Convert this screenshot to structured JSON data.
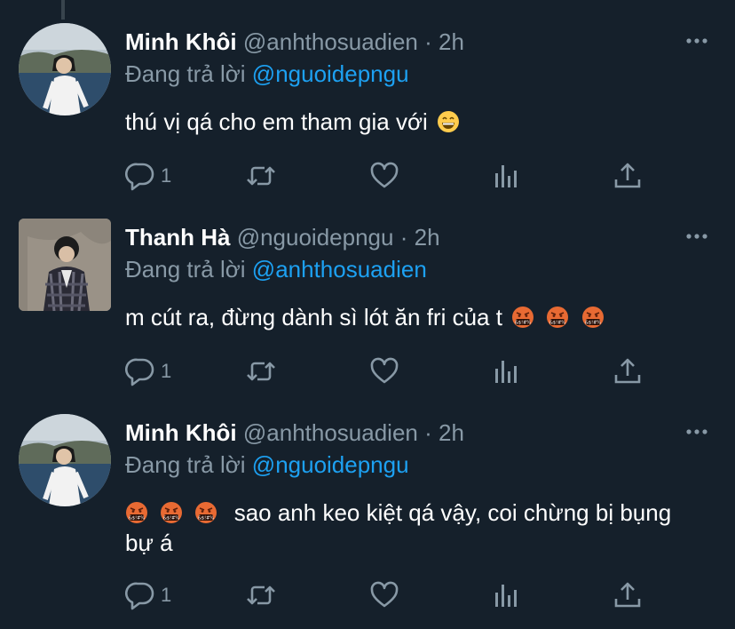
{
  "tweets": [
    {
      "name": "Minh Khôi",
      "handle": "@anhthosuadien",
      "separator": "·",
      "time": "2h",
      "reply_prefix": "Đang trả lời",
      "reply_to": "@nguoidepngu",
      "text": "thú vị qá cho em tham gia với",
      "emojis": [
        "grinning-face"
      ],
      "reply_count": "1"
    },
    {
      "name": "Thanh Hà",
      "handle": "@nguoidepngu",
      "separator": "·",
      "time": "2h",
      "reply_prefix": "Đang trả lời",
      "reply_to": "@anhthosuadien",
      "text": "m cút ra, đừng dành sì lót ăn fri của t",
      "emojis": [
        "face-with-symbols-on-mouth",
        "face-with-symbols-on-mouth",
        "face-with-symbols-on-mouth"
      ],
      "reply_count": "1"
    },
    {
      "name": "Minh Khôi",
      "handle": "@anhthosuadien",
      "separator": "·",
      "time": "2h",
      "reply_prefix": "Đang trả lời",
      "reply_to": "@nguoidepngu",
      "text": "sao anh keo kiệt qá vậy, coi chừng bị bụng bự á",
      "emojis": [
        "face-with-symbols-on-mouth",
        "face-with-symbols-on-mouth",
        "face-with-symbols-on-mouth"
      ],
      "reply_count": "1"
    }
  ],
  "colors": {
    "background": "#15202b",
    "primary_text": "#ffffff",
    "secondary_text": "#8899a6",
    "link": "#1da1f2",
    "thread_line": "#38444d"
  },
  "icons": [
    "more-icon",
    "reply-icon",
    "retweet-icon",
    "like-icon",
    "analytics-icon",
    "share-icon"
  ]
}
